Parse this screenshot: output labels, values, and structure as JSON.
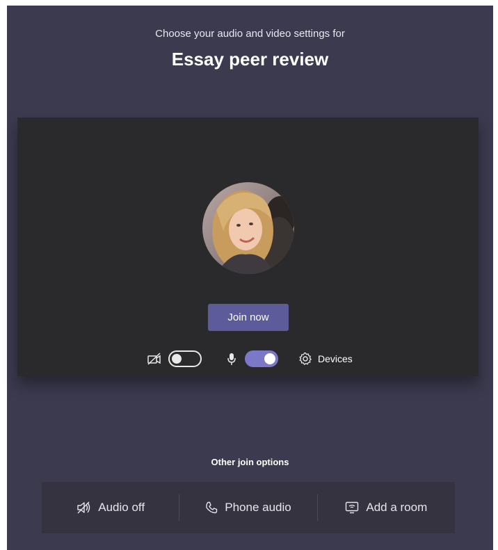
{
  "header": {
    "subtitle": "Choose your audio and video settings for",
    "meeting_title": "Essay peer review"
  },
  "preview": {
    "join_label": "Join now",
    "camera_toggle": "off",
    "mic_toggle": "on",
    "devices_label": "Devices"
  },
  "other_options": {
    "heading": "Other join options",
    "items": [
      {
        "label": "Audio off",
        "icon": "speaker-off-icon"
      },
      {
        "label": "Phone audio",
        "icon": "phone-icon"
      },
      {
        "label": "Add a room",
        "icon": "room-cast-icon"
      }
    ]
  },
  "colors": {
    "background": "#3b3a4e",
    "preview_bg": "#2a2a2c",
    "accent": "#5d5b99",
    "toggle_on": "#7b79c7"
  }
}
